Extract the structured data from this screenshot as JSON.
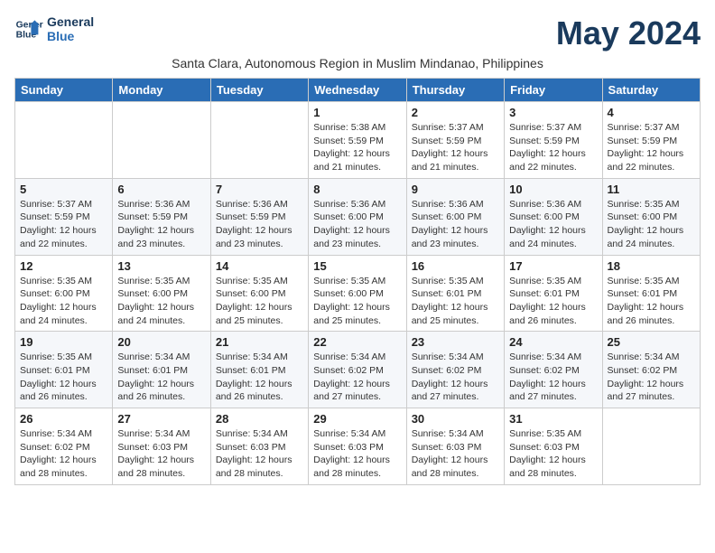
{
  "header": {
    "logo_line1": "General",
    "logo_line2": "Blue",
    "month_title": "May 2024",
    "subtitle": "Santa Clara, Autonomous Region in Muslim Mindanao, Philippines"
  },
  "days_of_week": [
    "Sunday",
    "Monday",
    "Tuesday",
    "Wednesday",
    "Thursday",
    "Friday",
    "Saturday"
  ],
  "weeks": [
    [
      {
        "day": "",
        "info": ""
      },
      {
        "day": "",
        "info": ""
      },
      {
        "day": "",
        "info": ""
      },
      {
        "day": "1",
        "info": "Sunrise: 5:38 AM\nSunset: 5:59 PM\nDaylight: 12 hours\nand 21 minutes."
      },
      {
        "day": "2",
        "info": "Sunrise: 5:37 AM\nSunset: 5:59 PM\nDaylight: 12 hours\nand 21 minutes."
      },
      {
        "day": "3",
        "info": "Sunrise: 5:37 AM\nSunset: 5:59 PM\nDaylight: 12 hours\nand 22 minutes."
      },
      {
        "day": "4",
        "info": "Sunrise: 5:37 AM\nSunset: 5:59 PM\nDaylight: 12 hours\nand 22 minutes."
      }
    ],
    [
      {
        "day": "5",
        "info": "Sunrise: 5:37 AM\nSunset: 5:59 PM\nDaylight: 12 hours\nand 22 minutes."
      },
      {
        "day": "6",
        "info": "Sunrise: 5:36 AM\nSunset: 5:59 PM\nDaylight: 12 hours\nand 23 minutes."
      },
      {
        "day": "7",
        "info": "Sunrise: 5:36 AM\nSunset: 5:59 PM\nDaylight: 12 hours\nand 23 minutes."
      },
      {
        "day": "8",
        "info": "Sunrise: 5:36 AM\nSunset: 6:00 PM\nDaylight: 12 hours\nand 23 minutes."
      },
      {
        "day": "9",
        "info": "Sunrise: 5:36 AM\nSunset: 6:00 PM\nDaylight: 12 hours\nand 23 minutes."
      },
      {
        "day": "10",
        "info": "Sunrise: 5:36 AM\nSunset: 6:00 PM\nDaylight: 12 hours\nand 24 minutes."
      },
      {
        "day": "11",
        "info": "Sunrise: 5:35 AM\nSunset: 6:00 PM\nDaylight: 12 hours\nand 24 minutes."
      }
    ],
    [
      {
        "day": "12",
        "info": "Sunrise: 5:35 AM\nSunset: 6:00 PM\nDaylight: 12 hours\nand 24 minutes."
      },
      {
        "day": "13",
        "info": "Sunrise: 5:35 AM\nSunset: 6:00 PM\nDaylight: 12 hours\nand 24 minutes."
      },
      {
        "day": "14",
        "info": "Sunrise: 5:35 AM\nSunset: 6:00 PM\nDaylight: 12 hours\nand 25 minutes."
      },
      {
        "day": "15",
        "info": "Sunrise: 5:35 AM\nSunset: 6:00 PM\nDaylight: 12 hours\nand 25 minutes."
      },
      {
        "day": "16",
        "info": "Sunrise: 5:35 AM\nSunset: 6:01 PM\nDaylight: 12 hours\nand 25 minutes."
      },
      {
        "day": "17",
        "info": "Sunrise: 5:35 AM\nSunset: 6:01 PM\nDaylight: 12 hours\nand 26 minutes."
      },
      {
        "day": "18",
        "info": "Sunrise: 5:35 AM\nSunset: 6:01 PM\nDaylight: 12 hours\nand 26 minutes."
      }
    ],
    [
      {
        "day": "19",
        "info": "Sunrise: 5:35 AM\nSunset: 6:01 PM\nDaylight: 12 hours\nand 26 minutes."
      },
      {
        "day": "20",
        "info": "Sunrise: 5:34 AM\nSunset: 6:01 PM\nDaylight: 12 hours\nand 26 minutes."
      },
      {
        "day": "21",
        "info": "Sunrise: 5:34 AM\nSunset: 6:01 PM\nDaylight: 12 hours\nand 26 minutes."
      },
      {
        "day": "22",
        "info": "Sunrise: 5:34 AM\nSunset: 6:02 PM\nDaylight: 12 hours\nand 27 minutes."
      },
      {
        "day": "23",
        "info": "Sunrise: 5:34 AM\nSunset: 6:02 PM\nDaylight: 12 hours\nand 27 minutes."
      },
      {
        "day": "24",
        "info": "Sunrise: 5:34 AM\nSunset: 6:02 PM\nDaylight: 12 hours\nand 27 minutes."
      },
      {
        "day": "25",
        "info": "Sunrise: 5:34 AM\nSunset: 6:02 PM\nDaylight: 12 hours\nand 27 minutes."
      }
    ],
    [
      {
        "day": "26",
        "info": "Sunrise: 5:34 AM\nSunset: 6:02 PM\nDaylight: 12 hours\nand 28 minutes."
      },
      {
        "day": "27",
        "info": "Sunrise: 5:34 AM\nSunset: 6:03 PM\nDaylight: 12 hours\nand 28 minutes."
      },
      {
        "day": "28",
        "info": "Sunrise: 5:34 AM\nSunset: 6:03 PM\nDaylight: 12 hours\nand 28 minutes."
      },
      {
        "day": "29",
        "info": "Sunrise: 5:34 AM\nSunset: 6:03 PM\nDaylight: 12 hours\nand 28 minutes."
      },
      {
        "day": "30",
        "info": "Sunrise: 5:34 AM\nSunset: 6:03 PM\nDaylight: 12 hours\nand 28 minutes."
      },
      {
        "day": "31",
        "info": "Sunrise: 5:35 AM\nSunset: 6:03 PM\nDaylight: 12 hours\nand 28 minutes."
      },
      {
        "day": "",
        "info": ""
      }
    ]
  ]
}
